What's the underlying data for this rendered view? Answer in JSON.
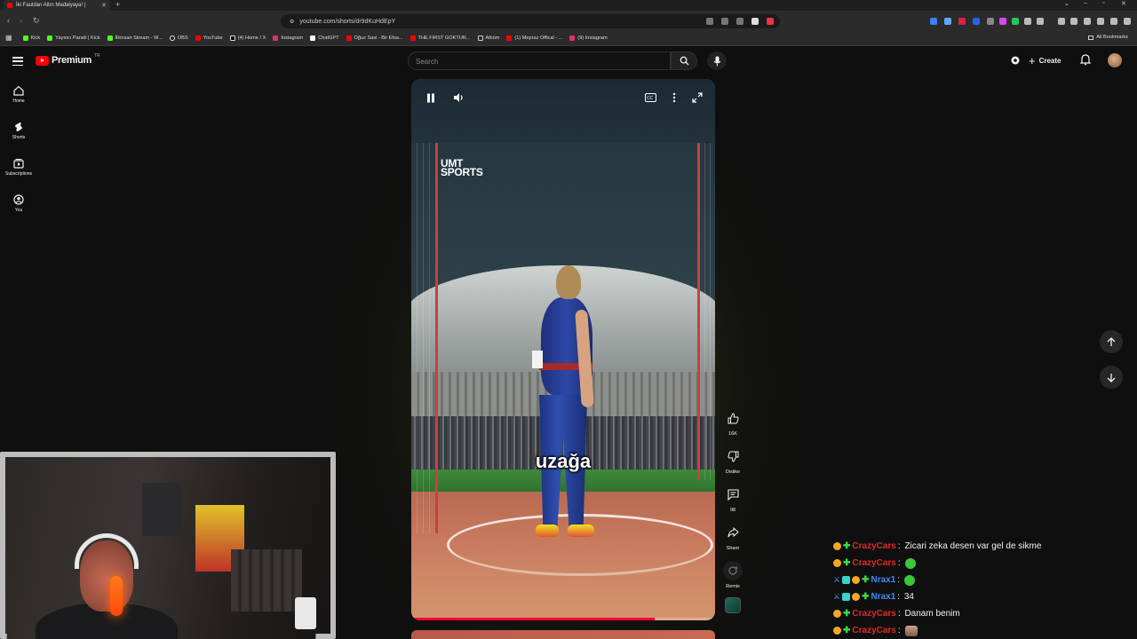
{
  "browser": {
    "tab_title": "İki Fauldan Altın Madalyaya! |",
    "url": "youtube.com/shorts/dr9dKuHdEpY",
    "bookmarks": [
      {
        "label": "Kick",
        "color": "#53fc18"
      },
      {
        "label": "Yayıncı Paneli | Kick",
        "color": "#53fc18"
      },
      {
        "label": "İlkinsan Stream - W...",
        "color": "#53fc18"
      },
      {
        "label": "OBS",
        "color": "#ffffff"
      },
      {
        "label": "YouTube",
        "color": "#ff0000"
      },
      {
        "label": "(4) Home / X",
        "color": "#ffffff"
      },
      {
        "label": "Instagram",
        "color": "#e1306c"
      },
      {
        "label": "ChatGPT",
        "color": "#ffffff"
      },
      {
        "label": "Oğuz Sasi - Bir Efsa...",
        "color": "#ff0000"
      },
      {
        "label": "THE FIRST GOKTUR...",
        "color": "#ff0000"
      },
      {
        "label": "Albüm",
        "color": "#cccccc"
      },
      {
        "label": "(1) Mepraz Offical - ...",
        "color": "#ff0000"
      },
      {
        "label": "(9) Instagram",
        "color": "#e1306c"
      }
    ],
    "all_bookmarks_label": "All Bookmarks"
  },
  "youtube": {
    "logo_word": "Premium",
    "logo_region": "TR",
    "search_placeholder": "Search",
    "create_label": "Create",
    "guide": [
      {
        "label": "Home",
        "icon": "home-icon"
      },
      {
        "label": "Shorts",
        "icon": "shorts-icon"
      },
      {
        "label": "Subscriptions",
        "icon": "subscriptions-icon"
      },
      {
        "label": "You",
        "icon": "you-icon"
      }
    ]
  },
  "short": {
    "watermark_line1": "UMT",
    "watermark_line2": "SPORTS",
    "caption": "uzağa",
    "progress": 0.8,
    "likes": "16K",
    "dislike_label": "Dislike",
    "comments": "98",
    "share_label": "Share",
    "remix_label": "Remix"
  },
  "chat": [
    {
      "nick": "CrazyCars",
      "nick_color": "red",
      "badges": [
        "orange",
        "green"
      ],
      "message": "Zicari zeka desen var gel de sikme",
      "emote": ""
    },
    {
      "nick": "CrazyCars",
      "nick_color": "red",
      "badges": [
        "orange",
        "green"
      ],
      "message": "",
      "emote": "green"
    },
    {
      "nick": "Nrax1",
      "nick_color": "blue",
      "badges": [
        "sword",
        "grid",
        "orange",
        "green"
      ],
      "message": "",
      "emote": "green"
    },
    {
      "nick": "Nrax1",
      "nick_color": "blue",
      "badges": [
        "sword",
        "grid",
        "orange",
        "green"
      ],
      "message": "34",
      "emote": ""
    },
    {
      "nick": "CrazyCars",
      "nick_color": "red",
      "badges": [
        "orange",
        "green"
      ],
      "message": "Danam benim",
      "emote": ""
    },
    {
      "nick": "CrazyCars",
      "nick_color": "red",
      "badges": [
        "orange",
        "green"
      ],
      "message": "",
      "emote": "face"
    }
  ]
}
